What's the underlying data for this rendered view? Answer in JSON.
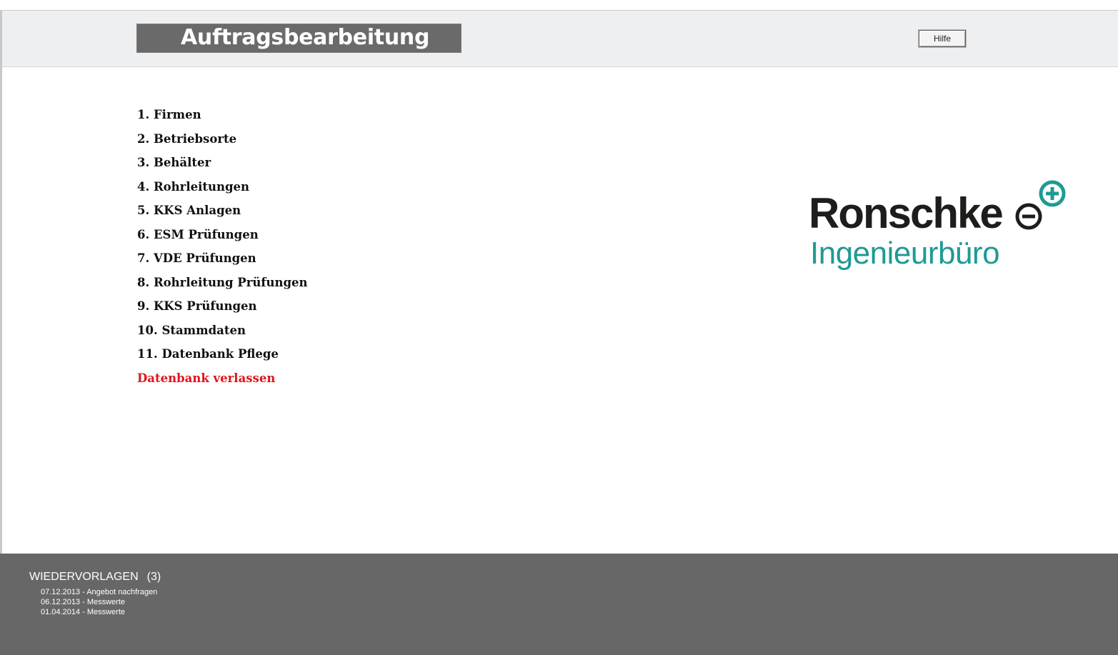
{
  "header": {
    "title": "Auftragsbearbeitung",
    "help_label": "Hilfe"
  },
  "menu": {
    "items": [
      {
        "label": "1. Firmen"
      },
      {
        "label": "2. Betriebsorte"
      },
      {
        "label": "3. Behälter"
      },
      {
        "label": "4. Rohrleitungen"
      },
      {
        "label": "5. KKS Anlagen"
      },
      {
        "label": "6. ESM Prüfungen"
      },
      {
        "label": "7. VDE Prüfungen"
      },
      {
        "label": "8. Rohrleitung Prüfungen"
      },
      {
        "label": "9. KKS Prüfungen"
      },
      {
        "label": "10. Stammdaten"
      },
      {
        "label": "11. Datenbank Pflege"
      }
    ],
    "exit_label": "Datenbank verlassen",
    "exit_color": "#e0141a"
  },
  "logo": {
    "name": "Ronschke",
    "subtitle": "Ingenieurbüro",
    "icon": "plus-minus-circles-icon",
    "accent_color": "#1f9a94"
  },
  "footer": {
    "heading": "WIEDERVORLAGEN",
    "count": "(3)",
    "items": [
      {
        "text": "07.12.2013 - Angebot nachfragen"
      },
      {
        "text": "06.12.2013 - Messwerte"
      },
      {
        "text": "01.04.2014 - Messwerte"
      }
    ]
  }
}
